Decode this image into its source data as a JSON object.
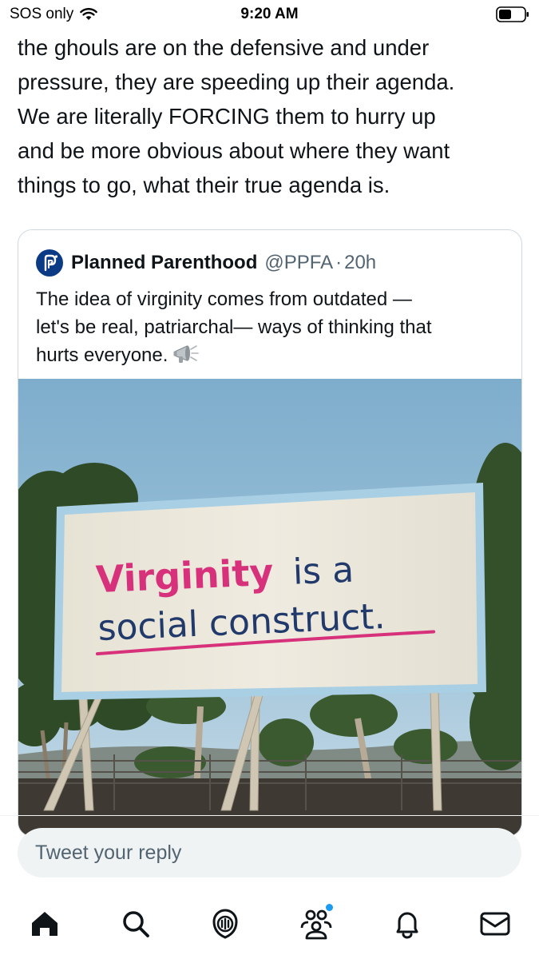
{
  "status_bar": {
    "carrier": "SOS only",
    "time": "9:20 AM"
  },
  "tweet": {
    "lines": [
      "the ghouls are on the defensive and under",
      "pressure, they are speeding up their agenda.",
      "We are literally FORCING them to hurry up",
      "and be more obvious about where they want",
      "things to go, what their true agenda is."
    ]
  },
  "quote": {
    "name": "Planned Parenthood",
    "handle": "@PPFA",
    "separator": "·",
    "time": "20h",
    "lines": [
      "The idea of virginity comes from outdated —",
      "let's be real, patriarchal— ways of thinking that",
      "hurts everyone."
    ],
    "emoji_icon": "megaphone-icon",
    "image": {
      "billboard_word_1": "Virginity",
      "billboard_word_2": "is a",
      "billboard_line_2": "social construct.",
      "colors": {
        "sky_top": "#7eadcc",
        "sky_bottom": "#c7dbe6",
        "billboard_face": "#ece8dc",
        "billboard_border": "#a9cfe4",
        "accent_pink": "#d8317c",
        "text_navy": "#213a6b"
      }
    }
  },
  "reply": {
    "placeholder": "Tweet your reply"
  },
  "tab_bar": {
    "items": [
      "home-icon",
      "search-icon",
      "spaces-icon",
      "communities-icon",
      "notifications-icon",
      "messages-icon"
    ]
  },
  "colors": {
    "text": "#0f1419",
    "secondary": "#536471",
    "accent": "#1d9bf0",
    "border": "#cfd9de"
  }
}
